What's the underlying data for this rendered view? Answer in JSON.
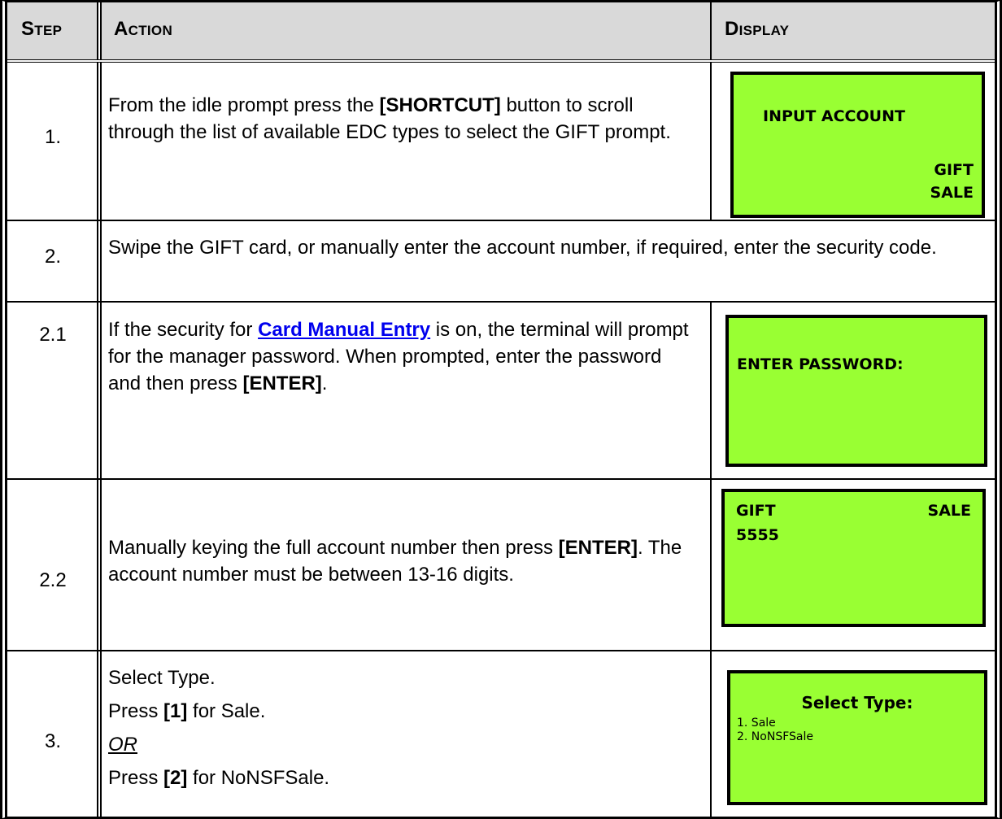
{
  "header": {
    "step": "Step",
    "action": "Action",
    "display": "Display"
  },
  "rows": [
    {
      "step": "1.",
      "action": {
        "pre": "From the idle prompt press the ",
        "bold": "[SHORTCUT]",
        "post": " button to scroll through the list of available EDC types to select the GIFT prompt."
      },
      "display": {
        "line1": "INPUT ACCOUNT",
        "line2": "GIFT",
        "line3": "SALE"
      }
    },
    {
      "step": "2.",
      "action": {
        "text": "Swipe the GIFT card, or manually enter the account number, if required, enter the security code."
      }
    },
    {
      "step": "2.1",
      "action": {
        "pre": "If the security for ",
        "link": "Card Manual Entry",
        "mid": " is on, the terminal will prompt for the manager password. When prompted, enter the password and then press ",
        "bold": "[ENTER]",
        "post": "."
      },
      "display": {
        "line1": "ENTER PASSWORD:"
      }
    },
    {
      "step": "2.2",
      "action": {
        "pre": "Manually keying the full account number then press ",
        "bold": "[ENTER]",
        "post": ". The account number must be between 13-16 digits."
      },
      "display": {
        "left": "GIFT",
        "right": "SALE",
        "line2": "5555"
      }
    },
    {
      "step": "3.",
      "action": {
        "l1": "Select Type.",
        "l2_pre": "Press ",
        "l2_bold": "[1]",
        "l2_post": " for Sale.",
        "l3": "OR",
        "l4_pre": "Press ",
        "l4_bold": "[2]",
        "l4_post": " for NoNSFSale."
      },
      "display": {
        "title": "Select Type:",
        "opt1": "1. Sale",
        "opt2": "2. NoNSFSale"
      }
    }
  ],
  "colors": {
    "lcd": "#99ff33",
    "header_bg": "#d9d9d9",
    "link": "#0000ee"
  }
}
